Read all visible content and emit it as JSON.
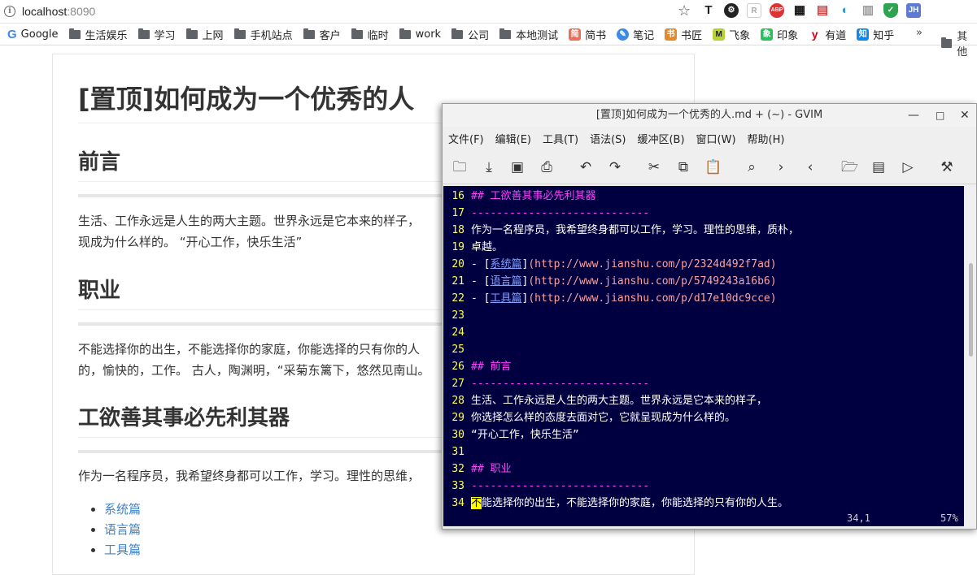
{
  "browser": {
    "url_host": "localhost",
    "url_port": ":8090",
    "bookmarks": [
      {
        "label": "Google",
        "icon": "google-icon"
      },
      {
        "label": "生活娱乐",
        "icon": "folder-icon"
      },
      {
        "label": "学习",
        "icon": "folder-icon"
      },
      {
        "label": "上网",
        "icon": "folder-icon"
      },
      {
        "label": "手机站点",
        "icon": "folder-icon"
      },
      {
        "label": "客户",
        "icon": "folder-icon"
      },
      {
        "label": "临时",
        "icon": "folder-icon"
      },
      {
        "label": "work",
        "icon": "folder-icon"
      },
      {
        "label": "公司",
        "icon": "folder-icon"
      },
      {
        "label": "本地测试",
        "icon": "folder-icon"
      },
      {
        "label": "简书",
        "icon": "jianshu-icon"
      },
      {
        "label": "笔记",
        "icon": "note-icon"
      },
      {
        "label": "书匠",
        "icon": "shujiang-icon"
      },
      {
        "label": "飞象",
        "icon": "feixiang-icon"
      },
      {
        "label": "印象",
        "icon": "evernote-icon"
      },
      {
        "label": "有道",
        "icon": "youdao-icon"
      },
      {
        "label": "知乎",
        "icon": "zhihu-icon"
      }
    ],
    "more": "»",
    "other_bookmarks": "其他"
  },
  "page": {
    "title": "[置顶]如何成为一个优秀的人",
    "sections": [
      {
        "heading": "前言",
        "text": [
          "生活、工作永远是人生的两大主题。世界永远是它本来的样子，",
          "现成为什么样的。 “开心工作，快乐生活”"
        ]
      },
      {
        "heading": "职业",
        "text": [
          "不能选择你的出生，不能选择你的家庭，你能选择的只有你的人",
          "的，愉快的，工作。 古人，陶渊明，“采菊东篱下，悠然见南山。"
        ]
      },
      {
        "heading": "工欲善其事必先利其器",
        "text": [
          "作为一名程序员，我希望终身都可以工作，学习。理性的思维，"
        ]
      }
    ],
    "links": [
      "系统篇",
      "语言篇",
      "工具篇"
    ]
  },
  "gvim": {
    "title": "[置顶]如何成为一个优秀的人.md + (~) - GVIM",
    "menus": [
      "文件(F)",
      "编辑(E)",
      "工具(T)",
      "语法(S)",
      "缓冲区(B)",
      "窗口(W)",
      "帮助(H)"
    ],
    "lines": [
      {
        "n": "16",
        "parts": [
          {
            "c": "head",
            "t": "## 工欲善其事必先利其器"
          }
        ]
      },
      {
        "n": "17",
        "parts": [
          {
            "c": "dash",
            "t": "----------------------------"
          }
        ]
      },
      {
        "n": "18",
        "parts": [
          {
            "c": "norm",
            "t": "作为一名程序员，我希望终身都可以工作，学习。理性的思维，质朴，"
          }
        ]
      },
      {
        "n": "19",
        "parts": [
          {
            "c": "norm",
            "t": "卓越。"
          }
        ]
      },
      {
        "n": "20",
        "parts": [
          {
            "c": "norm",
            "t": "- ["
          },
          {
            "c": "link",
            "t": "系统篇"
          },
          {
            "c": "norm",
            "t": "]"
          },
          {
            "c": "url",
            "t": "(http://www.jianshu.com/p/2324d492f7ad)"
          }
        ]
      },
      {
        "n": "21",
        "parts": [
          {
            "c": "norm",
            "t": "- ["
          },
          {
            "c": "link",
            "t": "语言篇"
          },
          {
            "c": "norm",
            "t": "]"
          },
          {
            "c": "url",
            "t": "(http://www.jianshu.com/p/5749243a16b6)"
          }
        ]
      },
      {
        "n": "22",
        "parts": [
          {
            "c": "norm",
            "t": "- ["
          },
          {
            "c": "link",
            "t": "工具篇"
          },
          {
            "c": "norm",
            "t": "]"
          },
          {
            "c": "url",
            "t": "(http://www.jianshu.com/p/d17e10dc9cce)"
          }
        ]
      },
      {
        "n": "23",
        "parts": []
      },
      {
        "n": "24",
        "parts": []
      },
      {
        "n": "25",
        "parts": []
      },
      {
        "n": "26",
        "parts": [
          {
            "c": "head",
            "t": "## 前言"
          }
        ]
      },
      {
        "n": "27",
        "parts": [
          {
            "c": "dash",
            "t": "----------------------------"
          }
        ]
      },
      {
        "n": "28",
        "parts": [
          {
            "c": "norm",
            "t": "生活、工作永远是人生的两大主题。世界永远是它本来的样子，"
          }
        ]
      },
      {
        "n": "29",
        "parts": [
          {
            "c": "norm",
            "t": "你选择怎么样的态度去面对它，它就呈现成为什么样的。"
          }
        ]
      },
      {
        "n": "30",
        "parts": [
          {
            "c": "norm",
            "t": "“开心工作，快乐生活”"
          }
        ]
      },
      {
        "n": "31",
        "parts": []
      },
      {
        "n": "32",
        "parts": [
          {
            "c": "head",
            "t": "## 职业"
          }
        ]
      },
      {
        "n": "33",
        "parts": [
          {
            "c": "dash",
            "t": "----------------------------"
          }
        ]
      },
      {
        "n": "34",
        "parts": [
          {
            "c": "cursor",
            "t": "不"
          },
          {
            "c": "norm",
            "t": "能选择你的出生，不能选择你的家庭，你能选择的只有你的人生。"
          }
        ]
      }
    ],
    "status_pos": "34,1",
    "status_pct": "57%"
  },
  "colors": {
    "editor_bg": "#000040",
    "line_number": "#ffff55",
    "heading": "#ff40ff",
    "link": "#80a0ff",
    "url": "#ffa0a0"
  }
}
